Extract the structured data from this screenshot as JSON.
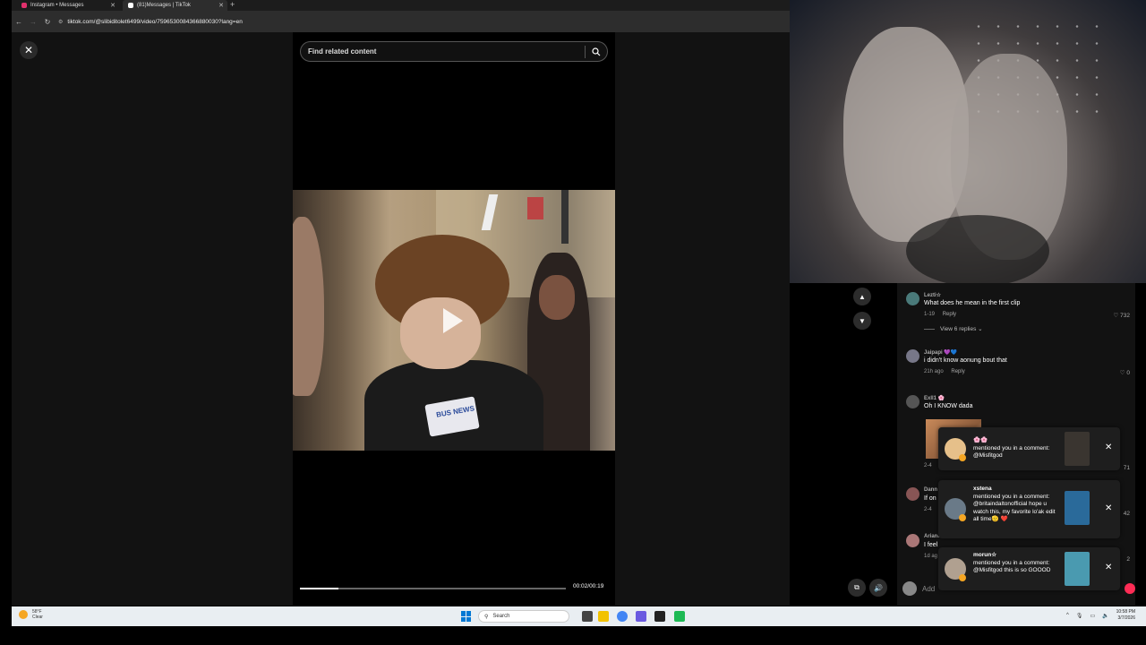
{
  "browser": {
    "tabs": [
      {
        "title": "Instagram • Messages"
      },
      {
        "title": "(81)Messages | TikTok"
      }
    ],
    "new_tab_label": "+",
    "url": "tiktok.com/@slibiditolet6499/video/7596530084366880030?lang=en"
  },
  "video": {
    "search_placeholder": "Find related content",
    "time": "00:02/00:19",
    "progress": 0.146,
    "mic_text": "BUS NEWS"
  },
  "comments": [
    {
      "user": "Lezti☆",
      "text": "What does he mean in the first clip",
      "date": "1-19",
      "reply": "Reply",
      "likes": "732",
      "view_replies": "View 6 replies"
    },
    {
      "user": "Jaipapi 💜💙",
      "text": "i didn't know aonung bout that",
      "date": "21h ago",
      "reply": "Reply",
      "likes": "0"
    },
    {
      "user": "Exll1 🌸",
      "text": "Oh I KNOW dada",
      "date": "2-4",
      "likes": "71"
    },
    {
      "user": "Dann",
      "text": "If on",
      "date": "2-4",
      "likes": "42"
    },
    {
      "user": "Ariana",
      "text": "I feel",
      "date": "1d ag",
      "likes": "2"
    }
  ],
  "comment_input": {
    "placeholder": "Add"
  },
  "notifications": [
    {
      "user": "🌸🌸",
      "text": "mentioned you in a comment: @Misfitgod"
    },
    {
      "user": "xstena",
      "text": "mentioned you in a comment: @britaindaltonofficial hope u watch this, my favorite lo'ak edit all time🫡 ❤️"
    },
    {
      "user": "morun☆",
      "text": "mentioned you in a comment: @Misfitgod this is so GOOOD"
    }
  ],
  "taskbar": {
    "weather_temp": "58°F",
    "weather_desc": "Clear",
    "search_label": "Search",
    "time": "10:58 PM",
    "date": "3/7/2026"
  },
  "colors": {
    "accent": "#fe2c55",
    "page_bg": "#121212",
    "taskbar_bg": "#e9eef2"
  }
}
